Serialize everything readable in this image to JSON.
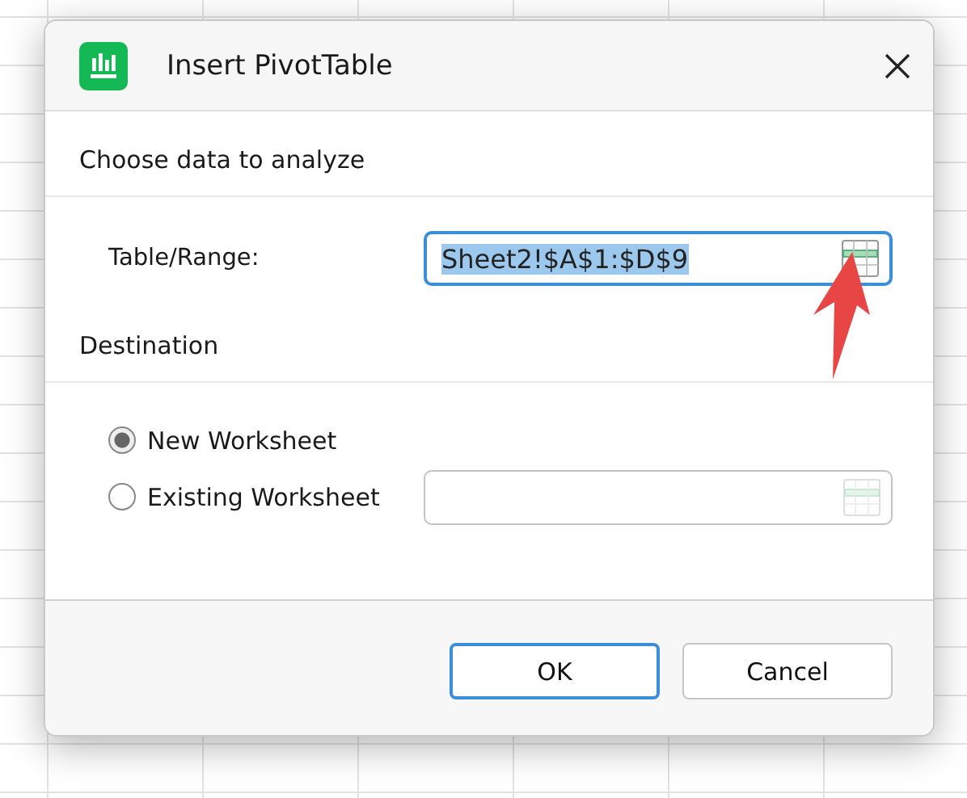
{
  "dialog": {
    "title": "Insert PivotTable",
    "source_section": {
      "heading": "Choose data to analyze",
      "range_label": "Table/Range:",
      "range_field": {
        "value": "Sheet2!$A$1:$D$9",
        "text_selected": true,
        "focused": true,
        "disabled": false
      }
    },
    "destination_section": {
      "heading": "Destination",
      "options": [
        {
          "label": "New Worksheet",
          "selected": true
        },
        {
          "label": "Existing Worksheet",
          "selected": false
        }
      ],
      "location_field": {
        "disabled": true,
        "focused": false
      }
    },
    "buttons": [
      {
        "label": "OK",
        "default": true
      },
      {
        "label": "Cancel",
        "default": false
      }
    ]
  }
}
